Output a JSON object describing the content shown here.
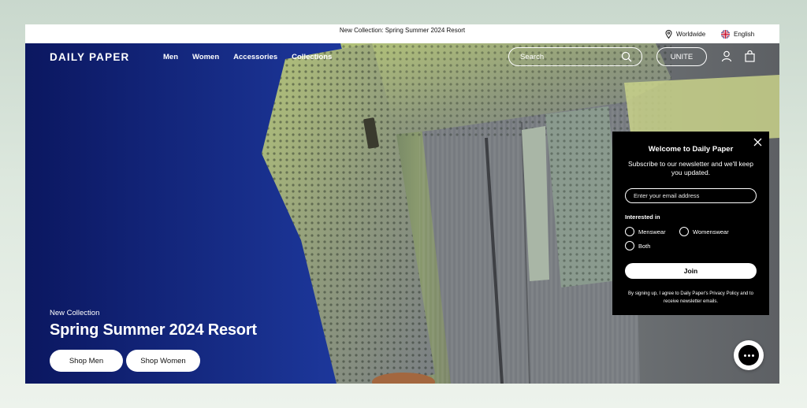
{
  "announcement": {
    "text": "New Collection: Spring Summer 2024 Resort"
  },
  "utility": {
    "region": "Worldwide",
    "language": "English"
  },
  "nav": {
    "logo": "DAILY PAPER",
    "items": [
      "Men",
      "Women",
      "Accessories",
      "Collections"
    ],
    "search_placeholder": "Search",
    "unite_label": "UNITE"
  },
  "hero": {
    "eyebrow": "New Collection",
    "headline": "Spring Summer 2024 Resort",
    "cta_men": "Shop Men",
    "cta_women": "Shop Women"
  },
  "popup": {
    "title": "Welcome to Daily Paper",
    "subtitle": "Subscribe to our newsletter and we'll keep you updated.",
    "email_placeholder": "Enter your email address",
    "interest_label": "Interested in",
    "options": [
      "Menswear",
      "Womenswear",
      "Both"
    ],
    "join_label": "Join",
    "legal": "By signing up, I agree to Daily Paper's Privacy Policy and to receive newsletter emails."
  },
  "colors": {
    "hero_blue": "#142a86",
    "knit_green": "#b9c77a",
    "popup_bg": "#000000"
  },
  "icons": [
    "location-pin-icon",
    "uk-flag-icon",
    "search-icon",
    "account-icon",
    "bag-icon",
    "close-icon",
    "chat-icon"
  ]
}
